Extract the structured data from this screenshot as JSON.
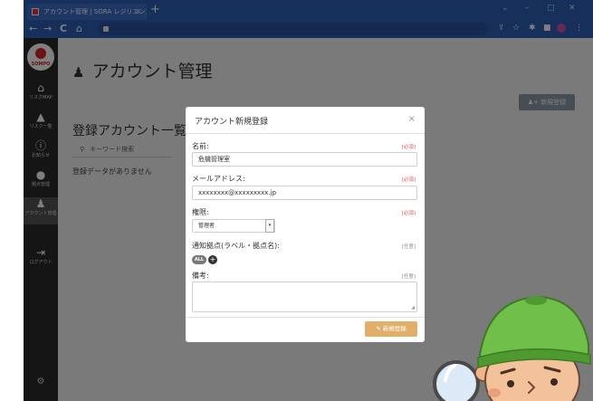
{
  "browser": {
    "tab_title": "アカウント管理 | SORA レジリエンス",
    "tab_close": "×",
    "new_tab": "+",
    "window_controls": [
      "⌄",
      "–",
      "□",
      "✕"
    ],
    "nav": [
      "←",
      "→",
      "C",
      "⌂"
    ]
  },
  "sidebar": {
    "logo_text": "SOMPO",
    "items": [
      {
        "icon": "map-icon",
        "label": "リスクMAP"
      },
      {
        "icon": "warning-icon",
        "label": "リスク一覧"
      },
      {
        "icon": "info-icon",
        "label": "お知らせ"
      },
      {
        "icon": "location-icon",
        "label": "拠点管理"
      },
      {
        "icon": "account-icon",
        "label": "アカウント管理"
      },
      {
        "icon": "logout-icon",
        "label": "ログアウト"
      }
    ]
  },
  "page": {
    "title": "アカウント管理",
    "new_button": "新規登録",
    "list_title": "登録アカウント一覧",
    "search_placeholder": "キーワード検索",
    "empty_text": "登録データがありません"
  },
  "modal": {
    "title": "アカウント新規登録",
    "close": "×",
    "name_label": "名前:",
    "name_required": "[必須]",
    "name_value": "危機管理室",
    "email_label": "メールアドレス:",
    "email_required": "[必須]",
    "email_value": "xxxxxxxx@xxxxxxxxx.jp",
    "role_label": "権限:",
    "role_required": "[必須]",
    "role_value": "管理者",
    "notify_label": "通知拠点(ラベル・拠点名):",
    "notify_optional": "[任意]",
    "notify_chip": "ALL",
    "notes_label": "備考:",
    "notes_optional": "[任意]",
    "submit": "新規登録"
  },
  "colors": {
    "browser_blue": "#2f5fb6",
    "sidebar": "#2b2b2b",
    "submit": "#e0b06a",
    "required": "#d9534f"
  }
}
